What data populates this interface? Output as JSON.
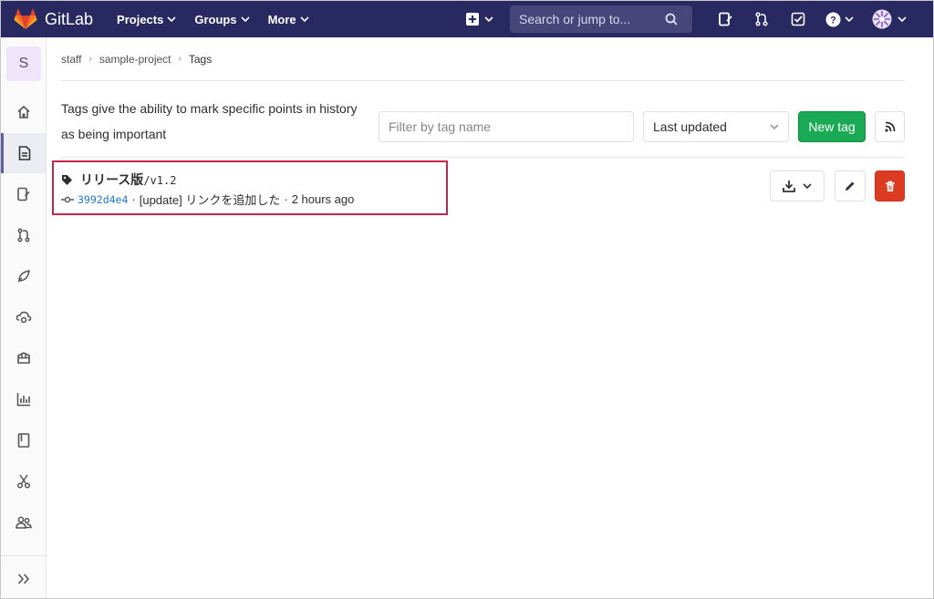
{
  "navbar": {
    "brand": "GitLab",
    "menu": [
      {
        "label": "Projects"
      },
      {
        "label": "Groups"
      },
      {
        "label": "More"
      }
    ],
    "search_placeholder": "Search or jump to...",
    "colors": {
      "bg": "#292961",
      "search_bg": "#46467a"
    }
  },
  "sidebar": {
    "project_initial": "S",
    "items": [
      {
        "icon": "home-icon"
      },
      {
        "icon": "repository-icon",
        "active": true
      },
      {
        "icon": "issues-icon"
      },
      {
        "icon": "merge-requests-icon"
      },
      {
        "icon": "ci-cd-rocket-icon"
      },
      {
        "icon": "operations-cloud-icon"
      },
      {
        "icon": "packages-icon"
      },
      {
        "icon": "analytics-chart-icon"
      },
      {
        "icon": "wiki-book-icon"
      },
      {
        "icon": "snippets-scissors-icon"
      },
      {
        "icon": "members-icon"
      }
    ],
    "collapse_icon": "double-chevron-right-icon"
  },
  "breadcrumb": {
    "items": [
      "staff",
      "sample-project"
    ],
    "current": "Tags"
  },
  "top_area": {
    "description": "Tags give the ability to mark specific points in history as being important",
    "filter_placeholder": "Filter by tag name",
    "sort_selected": "Last updated",
    "new_tag_label": "New tag"
  },
  "tags": [
    {
      "name_jp": "リリース版",
      "name_suffix": "/v1.2",
      "commit_sha": "3992d4e4",
      "commit_sep1": "·",
      "commit_message": "[update] リンクを追加した",
      "commit_sep2": "·",
      "commit_time": "2 hours ago"
    }
  ],
  "colors": {
    "new_tag_green": "#1aaa55",
    "delete_red": "#db3b21",
    "highlight_border": "#c7254e",
    "link_blue": "#1f78d1"
  }
}
